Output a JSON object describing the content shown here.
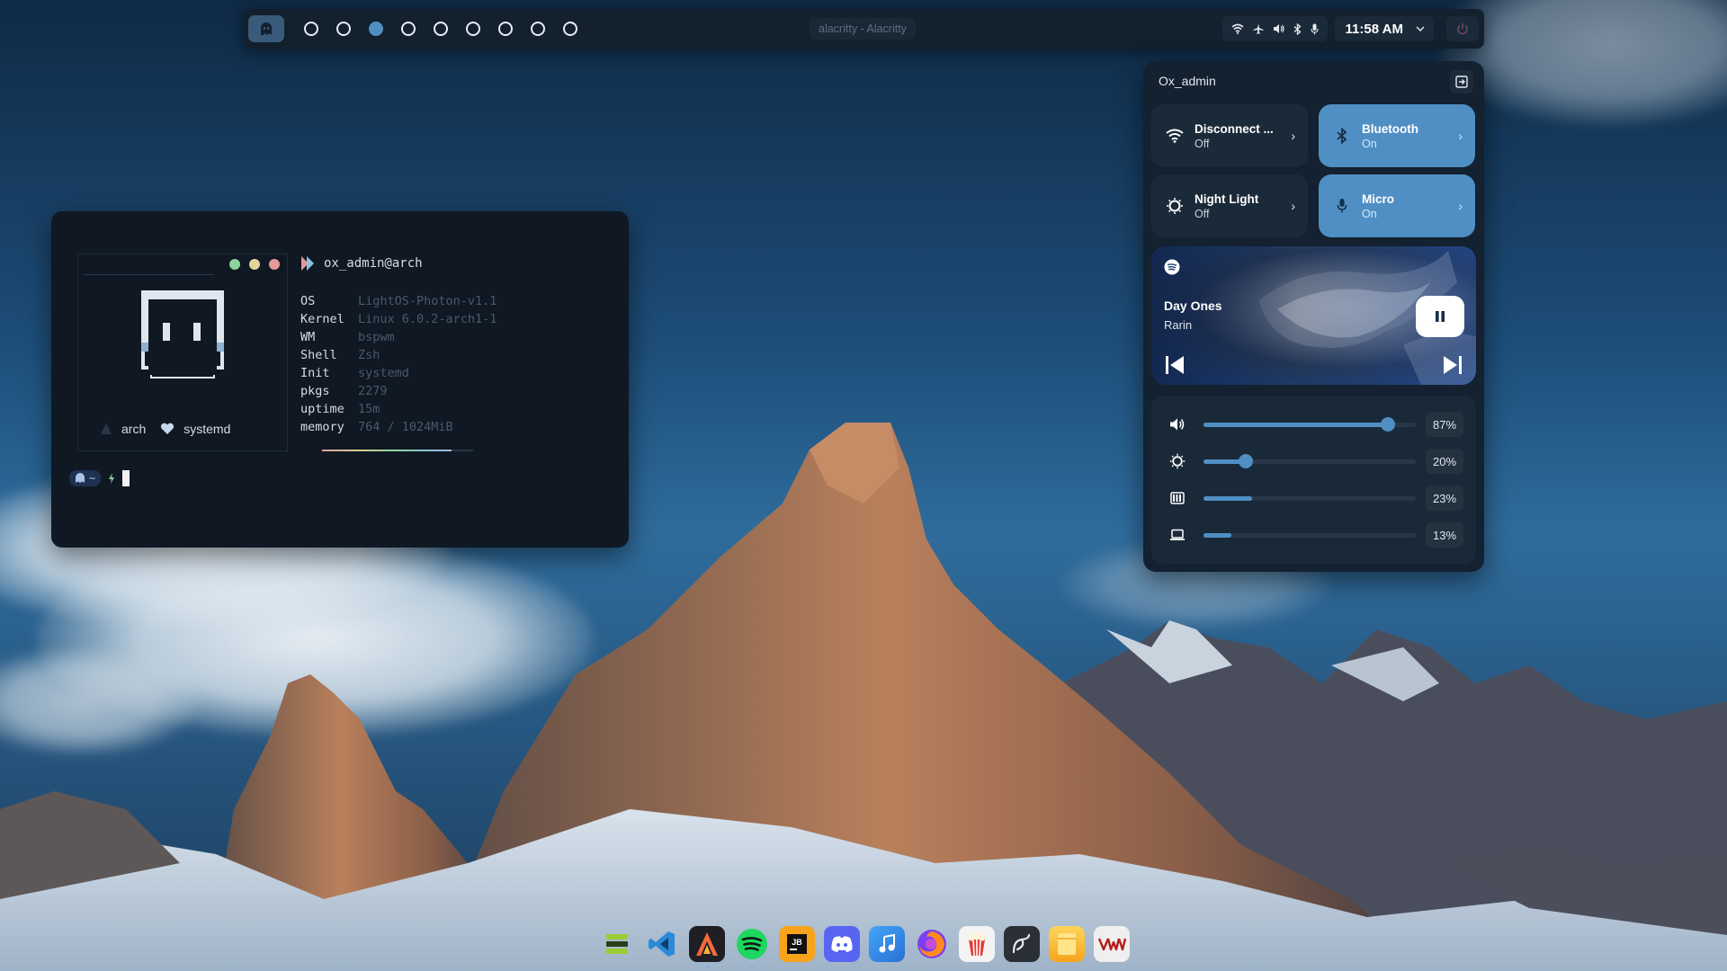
{
  "topbar": {
    "window_title": "alacritty - Alacritty",
    "workspaces": [
      false,
      false,
      true,
      false,
      false,
      false,
      false,
      false,
      false
    ],
    "time": "11:58 AM"
  },
  "terminal": {
    "host": "ox_admin@arch",
    "info": [
      {
        "key": "OS",
        "value": "LightOS-Photon-v1.1"
      },
      {
        "key": "Kernel",
        "value": "Linux 6.0.2-arch1-1"
      },
      {
        "key": "WM",
        "value": "bspwm"
      },
      {
        "key": "Shell",
        "value": "Zsh"
      },
      {
        "key": "Init",
        "value": "systemd"
      },
      {
        "key": "pkgs",
        "value": "2279"
      },
      {
        "key": "uptime",
        "value": "15m"
      },
      {
        "key": "memory",
        "value": "764 / 1024MiB"
      }
    ],
    "distro_label": "arch",
    "init_label": "systemd",
    "prompt_dir": "~",
    "dot_colors": [
      "#8fd39e",
      "#e2d59a",
      "#e59a9a"
    ]
  },
  "control_center": {
    "username": "Ox_admin",
    "tiles": {
      "wifi": {
        "title": "Disconnect ...",
        "status": "Off"
      },
      "bluetooth": {
        "title": "Bluetooth",
        "status": "On"
      },
      "night_light": {
        "title": "Night Light",
        "status": "Off"
      },
      "micro": {
        "title": "Micro",
        "status": "On"
      }
    },
    "player": {
      "song": "Day Ones",
      "artist": "Rarin"
    },
    "sliders": {
      "volume": {
        "label": "87%",
        "value": 87
      },
      "brightness": {
        "label": "20%",
        "value": 20
      },
      "battery": {
        "label": "23%",
        "value": 23
      },
      "screen": {
        "label": "13%",
        "value": 13
      }
    },
    "accent": "#4f8fc4"
  },
  "dock": {
    "apps": [
      "files-manager",
      "vscode",
      "alacritty",
      "spotify",
      "jetbrains-toolbox",
      "discord",
      "music",
      "firefox",
      "popcorn",
      "inkscape",
      "notes",
      "vmware"
    ]
  }
}
